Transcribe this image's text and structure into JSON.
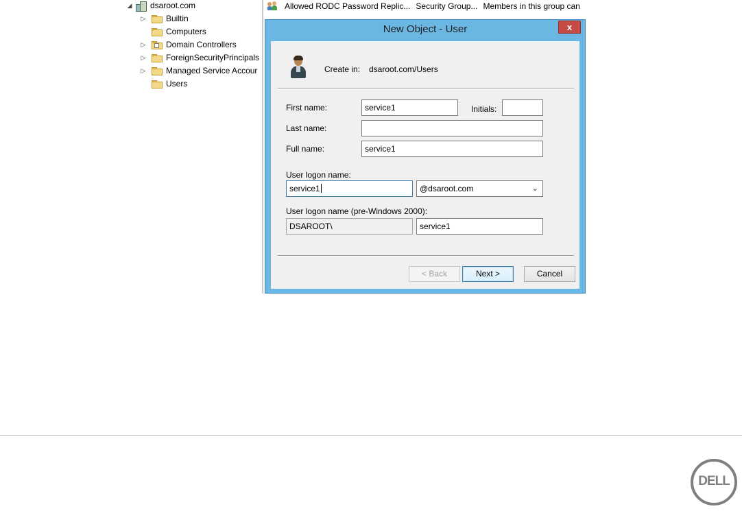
{
  "tree": {
    "root": {
      "label": "dsaroot.com",
      "toggle": "◢"
    },
    "items": [
      {
        "label": "Builtin",
        "toggle": "▷"
      },
      {
        "label": "Computers",
        "toggle": ""
      },
      {
        "label": "Domain Controllers",
        "toggle": "▷"
      },
      {
        "label": "ForeignSecurityPrincipals",
        "toggle": "▷"
      },
      {
        "label": "Managed Service Accour",
        "toggle": "▷"
      },
      {
        "label": "Users",
        "toggle": ""
      }
    ]
  },
  "list": {
    "row": {
      "name": "Allowed RODC Password Replic...",
      "type": "Security Group...",
      "description": "Members in this group can"
    }
  },
  "dialog": {
    "title": "New Object - User",
    "close_label": "x",
    "create_in_label": "Create in:",
    "create_in_path": "dsaroot.com/Users",
    "first_name_label": "First name:",
    "first_name_value": "service1",
    "initials_label": "Initials:",
    "initials_value": "",
    "last_name_label": "Last name:",
    "last_name_value": "",
    "full_name_label": "Full name:",
    "full_name_value": "service1",
    "logon_label": "User logon name:",
    "logon_value": "service1",
    "domain_suffix": "@dsaroot.com",
    "pre2000_label": "User logon name (pre-Windows 2000):",
    "pre2000_domain": "DSAROOT\\",
    "pre2000_value": "service1",
    "back_label": "< Back",
    "next_label": "Next >",
    "cancel_label": "Cancel"
  },
  "footer": {
    "logo_text": "DELL"
  }
}
